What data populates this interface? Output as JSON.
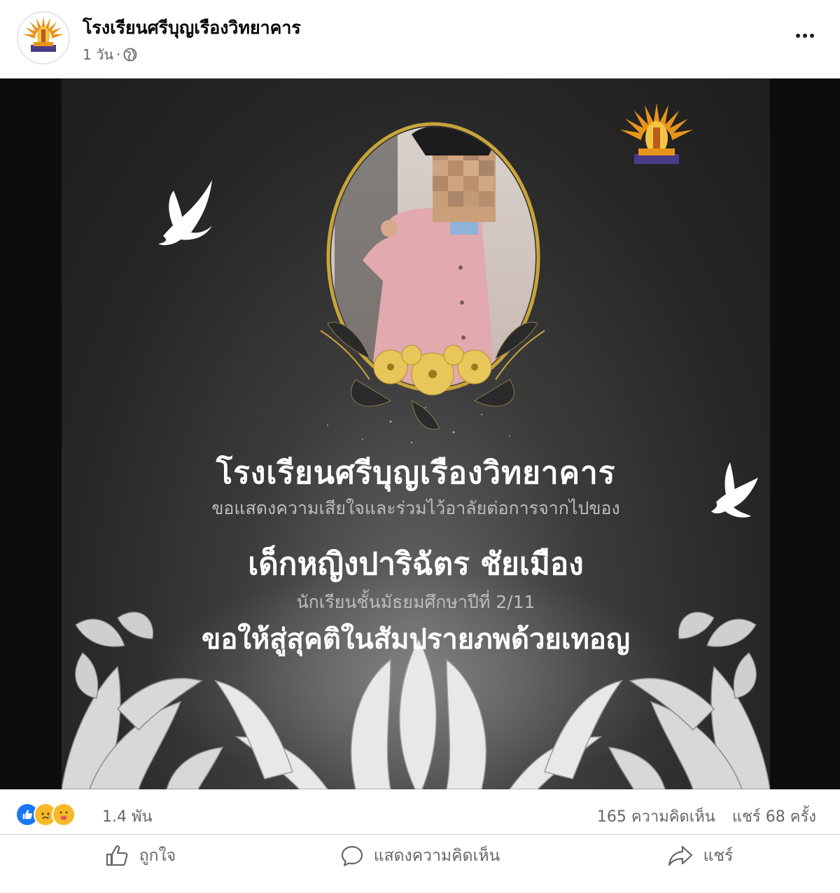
{
  "post": {
    "page_name": "โรงเรียนศรีบุญเรืองวิทยาคาร",
    "time": "1 วัน",
    "separator": "·",
    "privacy_icon": "globe-icon",
    "more_icon": "more-horizontal-icon"
  },
  "poster": {
    "school_name": "โรงเรียนศรีบุญเรืองวิทยาคาร",
    "condolence": "ขอแสดงความเสียใจและร่วมไว้อาลัยต่อการจากไปของ",
    "student_name": "เด็กหญิงปาริฉัตร  ชัยเมือง",
    "student_class": "นักเรียนชั้นมัธยมศึกษาปีที่ 2/11",
    "wish": "ขอให้สู่สุคติในสัมปรายภพด้วยเทอญ"
  },
  "reactions": {
    "icons": [
      "like-reaction-icon",
      "sad-reaction-icon",
      "care-reaction-icon"
    ],
    "count": "1.4 พัน",
    "comments": "165 ความคิดเห็น",
    "shares": "แชร์ 68 ครั้ง"
  },
  "actions": {
    "like": "ถูกใจ",
    "comment": "แสดงความคิดเห็น",
    "share": "แชร์"
  },
  "colors": {
    "accent": "#1877f2",
    "secondary_text": "#65676b",
    "poster_gold": "#c9a43a"
  }
}
